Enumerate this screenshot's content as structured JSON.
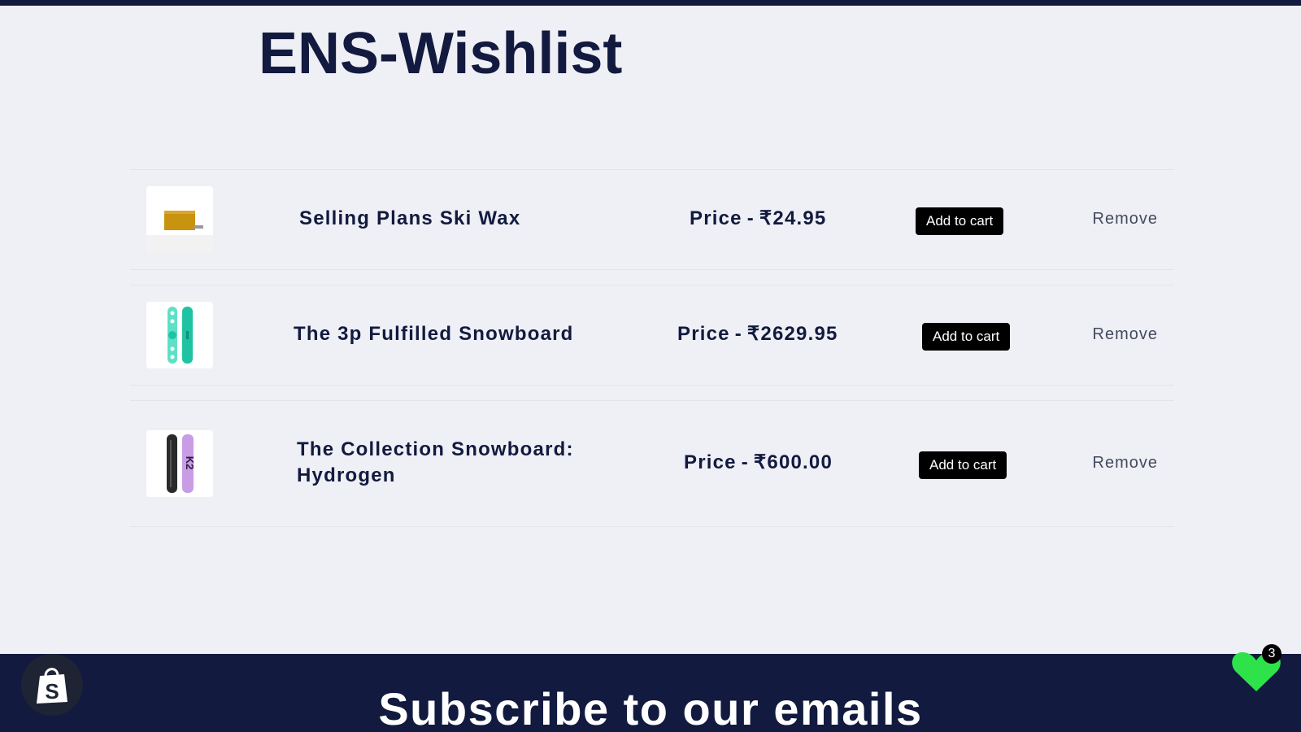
{
  "page": {
    "title": "ENS-Wishlist"
  },
  "wishlist": {
    "items": [
      {
        "name": "Selling Plans Ski Wax",
        "price_label": "Price",
        "price": "₹24.95",
        "add_label": "Add to cart",
        "remove_label": "Remove",
        "image_icon": "ski-wax-image"
      },
      {
        "name": "The 3p Fulfilled Snowboard",
        "price_label": "Price",
        "price": "₹2629.95",
        "add_label": "Add to cart",
        "remove_label": "Remove",
        "image_icon": "teal-snowboard-image"
      },
      {
        "name": "The Collection Snowboard: Hydrogen",
        "price_label": "Price",
        "price": "₹600.00",
        "add_label": "Add to cart",
        "remove_label": "Remove",
        "image_icon": "hydrogen-snowboard-image"
      }
    ]
  },
  "footer": {
    "heading": "Subscribe to our emails"
  },
  "floating": {
    "shopify_icon": "shopify-bag-icon",
    "wishlist_icon": "heart-icon",
    "wishlist_count": "3"
  },
  "colors": {
    "navy": "#121a3f",
    "background": "#eff0f5",
    "button": "#000000",
    "heart": "#2ee24a"
  }
}
